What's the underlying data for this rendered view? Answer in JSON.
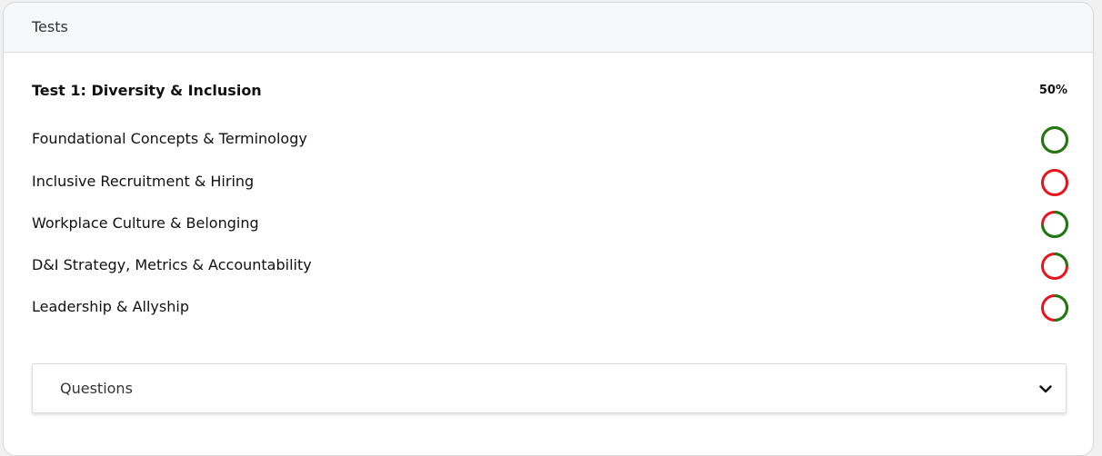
{
  "panel": {
    "title": "Tests"
  },
  "test": {
    "title": "Test 1: Diversity & Inclusion",
    "percent": "50%"
  },
  "topics": [
    {
      "label": "Foundational Concepts & Terminology",
      "score": 1.0
    },
    {
      "label": "Inclusive Recruitment & Hiring",
      "score": 0.0
    },
    {
      "label": "Workplace Culture & Belonging",
      "score": 0.75
    },
    {
      "label": "D&I Strategy, Metrics & Accountability",
      "score": 0.25
    },
    {
      "label": "Leadership & Allyship",
      "score": 0.5
    }
  ],
  "questions": {
    "label": "Questions",
    "icon": "chevron-down-icon"
  },
  "colors": {
    "correct": "#1e7a12",
    "incorrect": "#e8141b"
  }
}
